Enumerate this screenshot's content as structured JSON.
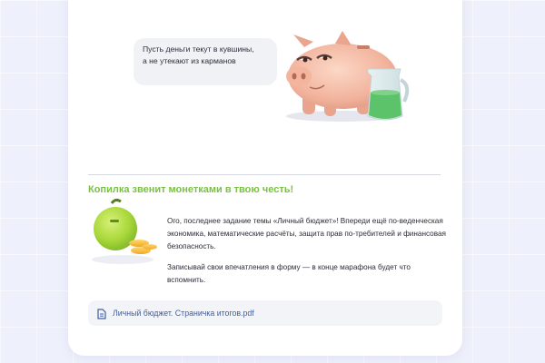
{
  "speech_bubble": {
    "line1": "Пусть деньги текут в кувшины,",
    "line2": "а не утекают из карманов"
  },
  "section": {
    "heading": "Копилка звенит монетками в твою честь!",
    "paragraph1": "Ого, последнее задание темы «Личный бюджет»! Впереди ещё по-веденческая экономика, математические расчёты, защита прав по-требителей и финансовая безопасность.",
    "paragraph2": "Записывай свои впечатления в форму — в конце марафона будет что вспомнить."
  },
  "attachment": {
    "icon": "document-icon",
    "filename": "Личный бюджет. Страничка итогов.pdf"
  },
  "colors": {
    "page_background": "#eef0fb",
    "card_background": "#ffffff",
    "heading_green": "#79c143",
    "link_blue": "#3e5fa8",
    "bubble_background": "#f1f2f6"
  }
}
